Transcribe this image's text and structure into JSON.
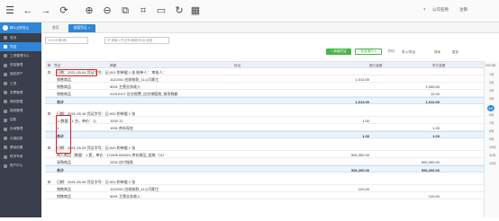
{
  "toolbar": {
    "icons": [
      "arrow-left-icon",
      "arrow-right-icon",
      "refresh-icon",
      "zoom-in-icon",
      "zoom-out-icon",
      "copy-icon",
      "crop-icon",
      "frame-icon",
      "rotate-icon",
      "calendar-icon"
    ],
    "right_items": [
      "?",
      "公司名称",
      "注销"
    ]
  },
  "sidebar": {
    "brand": "精斗云财务云",
    "items": [
      {
        "label": "首页",
        "active": false
      },
      {
        "label": "凭证",
        "active": true
      },
      {
        "label": "工资管理中心",
        "active": false
      },
      {
        "label": "资金管理",
        "active": false
      },
      {
        "label": "固定资产",
        "active": false
      },
      {
        "label": "工资",
        "active": false
      },
      {
        "label": "发票管理",
        "active": false
      },
      {
        "label": "期初数据",
        "active": false
      },
      {
        "label": "报税管理",
        "active": false
      },
      {
        "label": "结账",
        "active": false
      },
      {
        "label": "出纳管理",
        "active": false
      },
      {
        "label": "月度结账",
        "active": false
      },
      {
        "label": "基础设置",
        "active": false
      },
      {
        "label": "财务专家",
        "active": false
      },
      {
        "label": "账户中心",
        "active": false
      }
    ]
  },
  "tabs": [
    {
      "label": "首页",
      "active": false
    },
    {
      "label": "查看凭证 ×",
      "active": true
    }
  ],
  "filter": {
    "period_placeholder": "2021年第5期",
    "search_placeholder": "请输入凭证号/摘要/科目/金额",
    "buttons": {
      "add": "+ 新增凭证",
      "batch": "批量操作 ▾",
      "print": "打印",
      "import_export": "导入/导出",
      "sort": "排序",
      "more": "更多"
    }
  },
  "grid": {
    "headers": [
      "凭证",
      "摘要",
      "科目",
      "借方金额",
      "贷方金额"
    ],
    "vouchers": [
      {
        "head": "日期：2021-05-04  凭证字号：记-001  附单据 1 张  制单人：  审核人：  ",
        "rows": [
          {
            "summary": "销售商品",
            "account": "1122001 应收账款_11公司职工",
            "debit": "1,012.00",
            "credit": ""
          },
          {
            "summary": "销售商品",
            "account": "5001 主营业务收入",
            "debit": "",
            "credit": "1,000.00"
          },
          {
            "summary": "销售商品",
            "account": "22210107 应交税费_应交增值税_销项税额",
            "debit": "",
            "credit": "12.00"
          }
        ],
        "total_label": "合计",
        "total_debit": "1,012.00",
        "total_credit": "1,012.00"
      },
      {
        "head": "日期：2021-05-16  凭证字号：记-002  附单据 1 张",
        "rows": [
          {
            "summary": "1 (数量：1 台，单价：1)",
            "account": "1000 11",
            "debit": "1.00",
            "credit": ""
          },
          {
            "summary": "1",
            "account": "1001 库存现金",
            "debit": "",
            "credit": "1.00"
          }
        ],
        "total_label": "合计",
        "total_debit": "1.00",
        "total_credit": "1.00"
      },
      {
        "head": "日期：2021-05-25  凭证字号：记-003  附单据 1 张",
        "rows": [
          {
            "summary": "购入商品（数量：1 套，单价：1）",
            "account": "1405.000001 库存商品_组装（11）",
            "debit": "592,000.00",
            "credit": ""
          },
          {
            "summary": "采购商品",
            "account": "2202 应付账款",
            "debit": "",
            "credit": "592,000.00"
          }
        ],
        "total_label": "合计",
        "total_debit": "592,200.00",
        "total_credit": "592,200.00"
      },
      {
        "head": "日期：2021-05-26  凭证字号：记-004  附单据 1 张",
        "rows": [
          {
            "summary": "销售商品",
            "account": "1122001 应收账款_11公司职工",
            "debit": "120.00",
            "credit": ""
          },
          {
            "summary": "销售商品",
            "account": "5001 主营业务收入",
            "debit": "",
            "credit": "120.00"
          }
        ]
      }
    ]
  },
  "date_panel": {
    "year": "2021年",
    "months": [
      "1月",
      "2月",
      "3月",
      "4月",
      "5月",
      "6月",
      "7月",
      "8月",
      "9月",
      "10月",
      "11月",
      "12月"
    ],
    "active_month": "5月"
  },
  "colors": {
    "sidebar_bg": "#3a3f4b",
    "accent": "#2f86d6",
    "highlight_box": "#e02020",
    "total_row": "#eaf4fd"
  }
}
